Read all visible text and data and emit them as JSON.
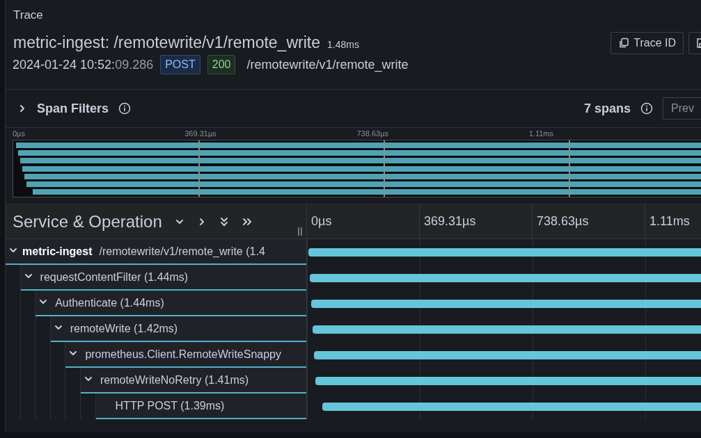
{
  "panel": {
    "title": "Trace"
  },
  "header": {
    "title": "metric-ingest: /remotewrite/v1/remote_write",
    "duration": "1.48ms",
    "timestamp": "2024-01-24 10:52:",
    "timestamp_seconds": "09.286",
    "method": "POST",
    "status": "200",
    "url": "/remotewrite/v1/remote_write",
    "buttons": [
      {
        "kind": "copy",
        "label": "Trace ID"
      },
      {
        "kind": "save"
      }
    ]
  },
  "span_filters": {
    "label": "Span Filters",
    "expanded": false,
    "count": "7 spans",
    "prev_button": "Prev"
  },
  "minimap": {
    "ticks": [
      "0µs",
      "369.31µs",
      "738.63µs",
      "1.11ms"
    ]
  },
  "table": {
    "column_title": "Service & Operation",
    "ticks": [
      "0µs",
      "369.31µs",
      "738.63µs",
      "1.11ms"
    ],
    "spans": [
      {
        "service": "metric-ingest",
        "operation": "/remotewrite/v1/remote_write (1.4",
        "expanded": true,
        "children": [
          {
            "operation": "requestContentFilter (1.44ms)",
            "expanded": true,
            "children": [
              {
                "operation": "Authenticate (1.44ms)",
                "expanded": true,
                "children": [
                  {
                    "operation": "remoteWrite (1.42ms)",
                    "expanded": true,
                    "children": [
                      {
                        "operation": "prometheus.Client.RemoteWriteSnappy",
                        "expanded": true,
                        "children": [
                          {
                            "operation": "remoteWriteNoRetry (1.41ms)",
                            "expanded": true,
                            "children": [
                              {
                                "operation": "HTTP POST (1.39ms)"
                              }
                            ]
                          }
                        ]
                      }
                    ]
                  }
                ]
              }
            ]
          }
        ]
      }
    ]
  }
}
